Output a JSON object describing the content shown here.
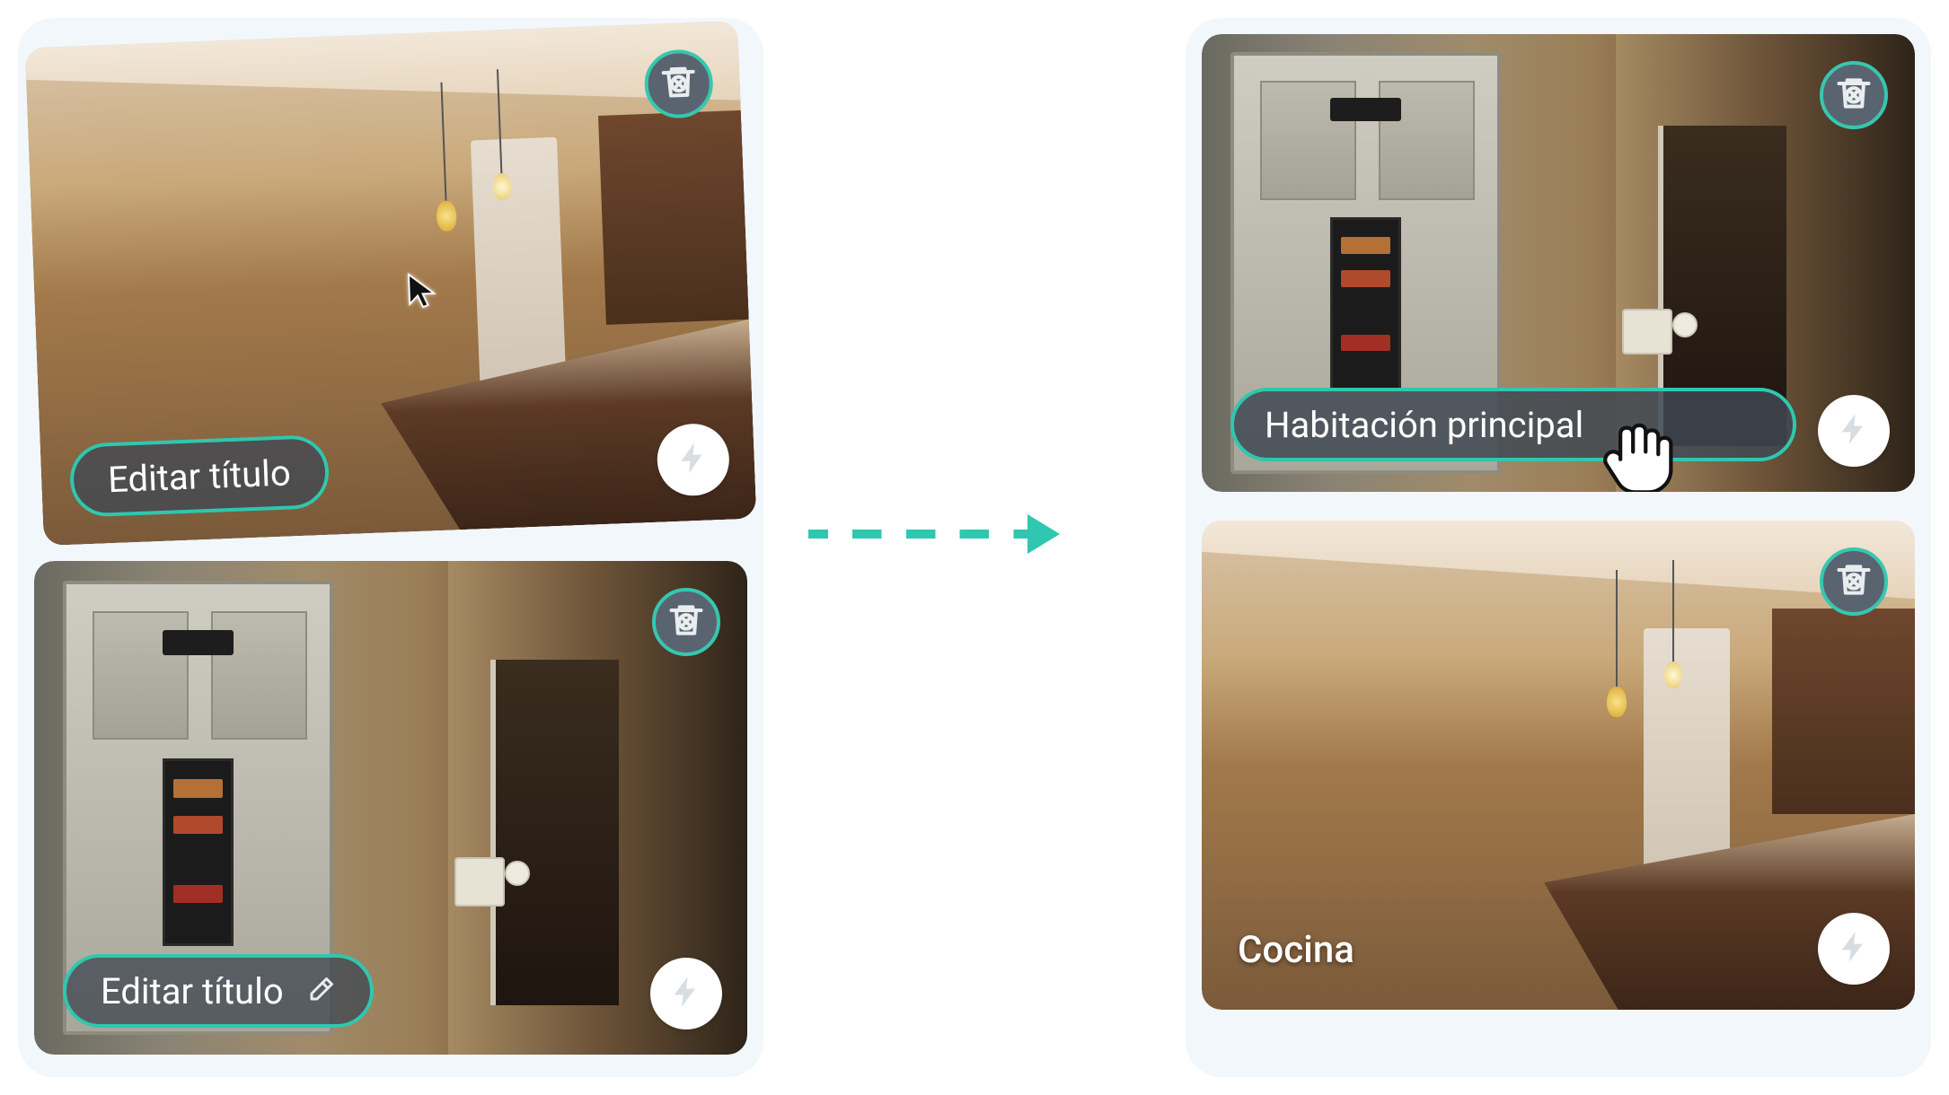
{
  "left": {
    "cards": [
      {
        "title_button": "Editar título",
        "show_pencil": false
      },
      {
        "title_button": "Editar título",
        "show_pencil": true
      }
    ]
  },
  "right": {
    "cards": [
      {
        "title_value": "Habitación principal",
        "editing": true
      },
      {
        "title_value": "Cocina",
        "editing": false
      }
    ]
  },
  "icons": {
    "delete": "trash-cancel-icon",
    "flash": "lightning-icon",
    "pencil": "pencil-icon",
    "save": "save-icon"
  },
  "colors": {
    "accent": "#2fc7af",
    "pill_bg": "rgba(64,72,82,0.78)",
    "panel_bg": "#f2f7fb"
  }
}
